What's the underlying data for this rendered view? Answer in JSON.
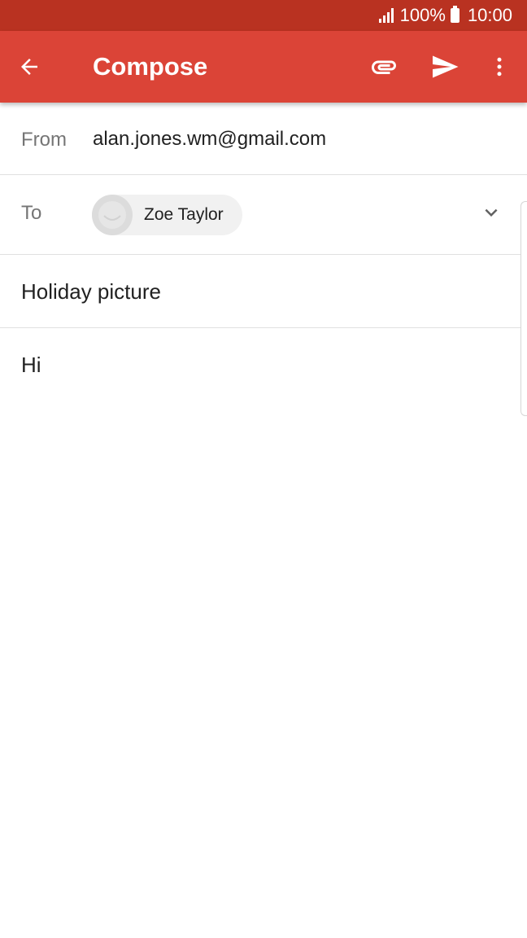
{
  "status_bar": {
    "battery_text": "100%",
    "time": "10:00"
  },
  "app_bar": {
    "title": "Compose",
    "color": "#db4437",
    "status_color": "#b93221",
    "icons": [
      "arrow-back-icon",
      "paperclip-icon",
      "send-icon",
      "more-vert-icon"
    ]
  },
  "from": {
    "label": "From",
    "value": "alan.jones.wm@gmail.com"
  },
  "to": {
    "label": "To",
    "recipients": [
      {
        "name": "Zoe Taylor"
      }
    ]
  },
  "subject": {
    "value": "Holiday picture"
  },
  "body": {
    "value": "Hi"
  }
}
